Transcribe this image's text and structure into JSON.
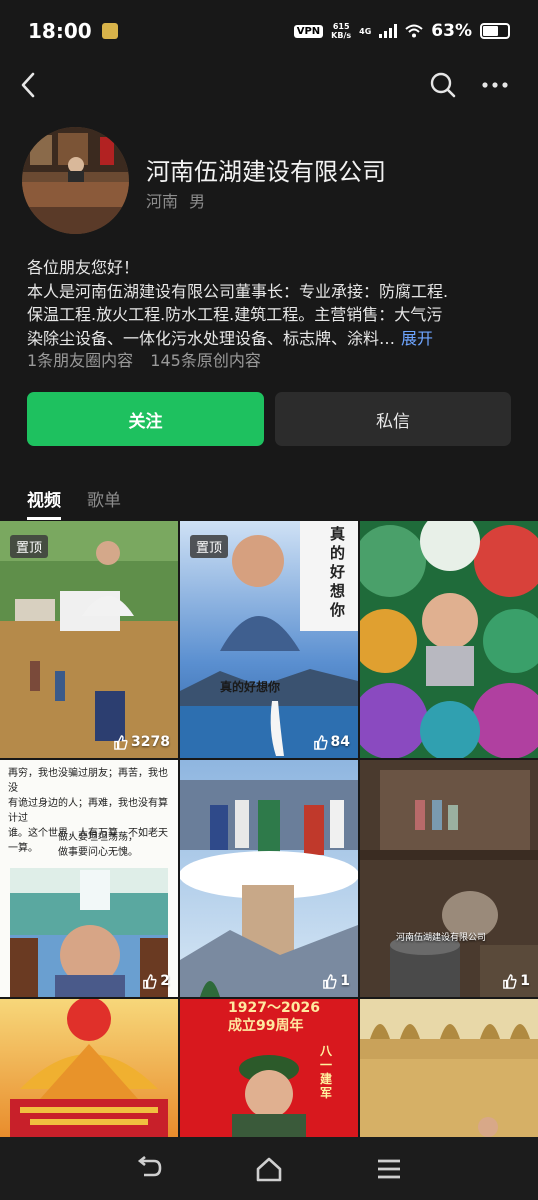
{
  "status": {
    "time": "18:00",
    "vpn": "VPN",
    "speed_top": "615",
    "speed_bottom": "KB/s",
    "network": "4G",
    "battery": "63%"
  },
  "profile": {
    "name": "河南伍湖建设有限公司",
    "region": "河南",
    "gender": "男",
    "bio_lines": [
      "各位朋友您好！",
      "本人是河南伍湖建设有限公司董事长：专业承接：防腐工程.",
      "保温工程.放火工程.防水工程.建筑工程。主营销售：大气污",
      "染除尘设备、一体化污水处理设备、标志牌、涂料…"
    ],
    "expand": "展开",
    "moments": "1条朋友圈内容",
    "original": "145条原创内容"
  },
  "actions": {
    "follow": "关注",
    "message": "私信"
  },
  "tabs": [
    "视频",
    "歌单"
  ],
  "videos": [
    {
      "pinned": "置顶",
      "likes": "3278"
    },
    {
      "pinned": "置顶",
      "likes": "84",
      "caption_top": "真的好想你",
      "caption_mid": "真的好想你"
    },
    {
      "likes": ""
    },
    {
      "likes": "2",
      "text_lines": [
        "再穷，我也没骗过朋友；再苦，我也没",
        "有诡过身边的人；再难，我也没有算计过",
        "谁。这个世界，人有万算，不如老天一算。"
      ],
      "motto_1": "做人要坦坦荡荡，",
      "motto_2": "做事要问心无愧。"
    },
    {
      "likes": "1"
    },
    {
      "likes": "1",
      "watermark": "河南伍湖建设有限公司"
    },
    {
      "likes": ""
    },
    {
      "likes": "",
      "years": "1927～2026",
      "anniv": "成立99周年",
      "slogan": "八一建军"
    },
    {
      "likes": ""
    }
  ]
}
